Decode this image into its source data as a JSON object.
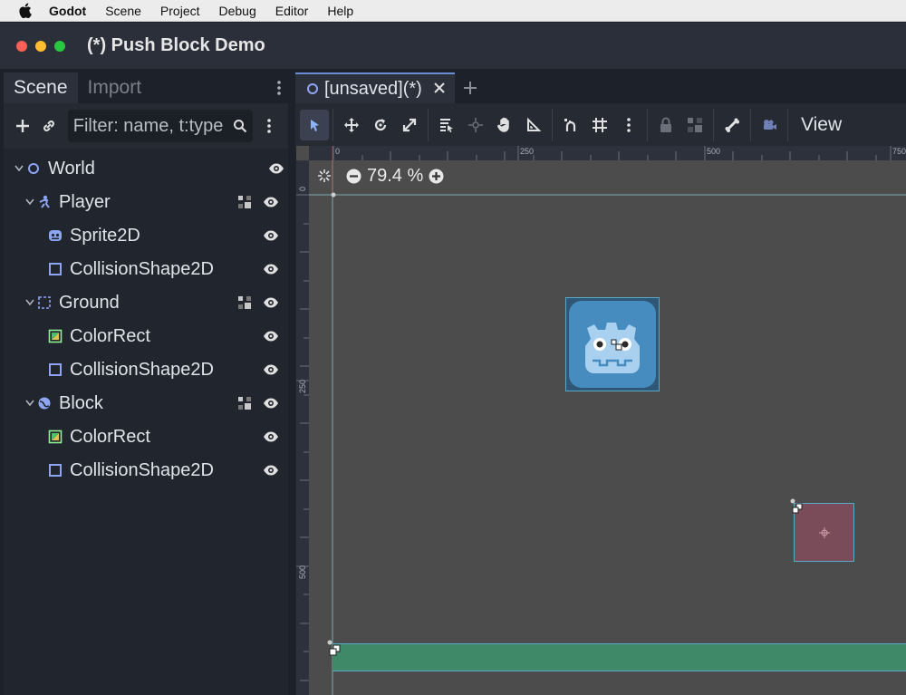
{
  "menubar": {
    "app": "Godot",
    "items": [
      "Scene",
      "Project",
      "Debug",
      "Editor",
      "Help"
    ]
  },
  "window": {
    "title": "(*) Push Block Demo"
  },
  "scene_dock": {
    "tabs": [
      "Scene",
      "Import"
    ],
    "active_tab": "Scene",
    "filter_placeholder": "Filter: name, t:type"
  },
  "scene_tree": [
    {
      "label": "World",
      "icon": "node2d-circle-icon",
      "indent": 0,
      "expandable": true,
      "grouped": false
    },
    {
      "label": "Player",
      "icon": "character-body-icon",
      "indent": 1,
      "expandable": true,
      "grouped": true
    },
    {
      "label": "Sprite2D",
      "icon": "sprite-icon",
      "indent": 2,
      "expandable": false,
      "grouped": false
    },
    {
      "label": "CollisionShape2D",
      "icon": "collision-shape-icon",
      "indent": 2,
      "expandable": false,
      "grouped": false
    },
    {
      "label": "Ground",
      "icon": "static-body-icon",
      "indent": 1,
      "expandable": true,
      "grouped": true
    },
    {
      "label": "ColorRect",
      "icon": "color-rect-icon",
      "indent": 2,
      "expandable": false,
      "grouped": false
    },
    {
      "label": "CollisionShape2D",
      "icon": "collision-shape-icon",
      "indent": 2,
      "expandable": false,
      "grouped": false
    },
    {
      "label": "Block",
      "icon": "rigid-body-icon",
      "indent": 1,
      "expandable": true,
      "grouped": true
    },
    {
      "label": "ColorRect",
      "icon": "color-rect-icon",
      "indent": 2,
      "expandable": false,
      "grouped": false
    },
    {
      "label": "CollisionShape2D",
      "icon": "collision-shape-icon",
      "indent": 2,
      "expandable": false,
      "grouped": false
    }
  ],
  "editor": {
    "tab_label": "[unsaved](*)",
    "view_label": "View",
    "zoom_text": "79.4 %",
    "ruler_top_labels": [
      "0",
      "250",
      "500",
      "750"
    ],
    "ruler_left_labels": [
      "0",
      "250",
      "500"
    ]
  },
  "colors": {
    "accent": "#6b8bd4",
    "ground": "#3f8868",
    "block": "#7a4c5a",
    "godot_blue": "#478cbf"
  }
}
